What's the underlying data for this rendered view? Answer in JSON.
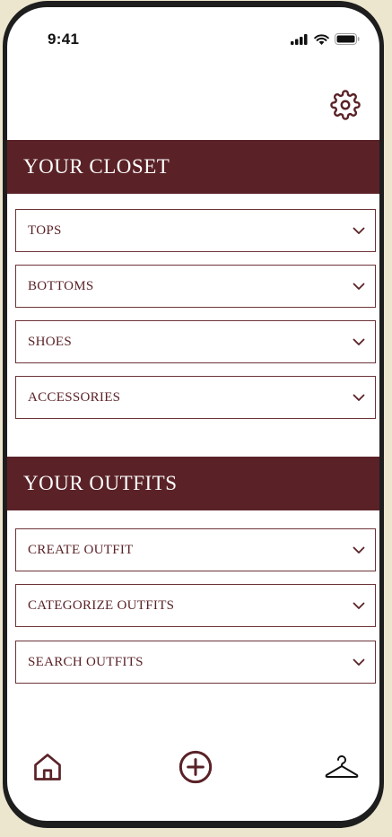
{
  "status_bar": {
    "time": "9:41",
    "icons": [
      "signal-icon",
      "wifi-icon",
      "battery-icon"
    ]
  },
  "settings": {
    "icon": "gear-icon"
  },
  "closet": {
    "title": "YOUR CLOSET",
    "items": [
      {
        "label": "TOPS"
      },
      {
        "label": "BOTTOMS"
      },
      {
        "label": "SHOES"
      },
      {
        "label": "ACCESSORIES"
      }
    ]
  },
  "outfits": {
    "title": "YOUR OUTFITS",
    "items": [
      {
        "label": "CREATE OUTFIT"
      },
      {
        "label": "CATEGORIZE OUTFITS"
      },
      {
        "label": "SEARCH OUTFITS"
      }
    ]
  },
  "bottom_nav": {
    "items": [
      "home-icon",
      "add-circle-icon",
      "hanger-icon"
    ]
  },
  "colors": {
    "accent": "#5a2227",
    "background": "#ffffff",
    "frame": "#1e1e1e",
    "page": "#ece6cf"
  }
}
